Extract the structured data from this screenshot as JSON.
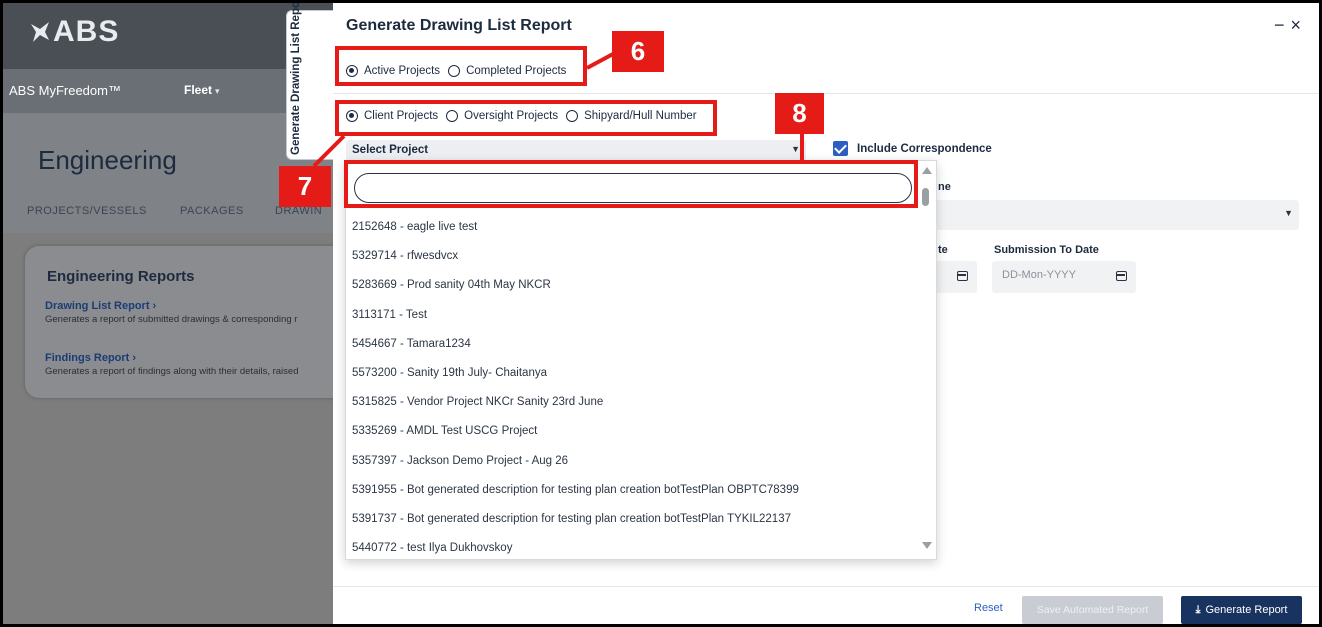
{
  "background_app": {
    "logo_text": "ABS",
    "brand": "ABS MyFreedom™",
    "fleet_label": "Fleet",
    "page_title": "Engineering",
    "tabs": [
      "PROJECTS/VESSELS",
      "PACKAGES",
      "DRAWIN"
    ],
    "reports_card": {
      "title": "Engineering Reports",
      "links": [
        {
          "label": "Drawing List Report  ›",
          "desc": "Generates a report of submitted drawings & corresponding r"
        },
        {
          "label": "Findings Report  ›",
          "desc": "Generates a report of findings along with their details, raised"
        }
      ]
    },
    "side_tab": "Generate Drawing List Report"
  },
  "modal": {
    "title": "Generate Drawing List Report",
    "minimize": "−",
    "close": "×",
    "project_status": [
      {
        "label": "Active Projects",
        "selected": true
      },
      {
        "label": "Completed Projects",
        "selected": false
      }
    ],
    "project_type": [
      {
        "label": "Client Projects",
        "selected": true
      },
      {
        "label": "Oversight Projects",
        "selected": false
      },
      {
        "label": "Shipyard/Hull Number",
        "selected": false
      }
    ],
    "select_project_label": "Select Project",
    "include_correspondence": "Include Correspondence",
    "partial_label_ne": "ne",
    "partial_label_te": "te",
    "submission_to_date_label": "Submission To Date",
    "date_placeholder": "DD-Mon-YYYY",
    "search_value": "",
    "projects": [
      "2152648 - eagle live test",
      "5329714 - rfwesdvcx",
      "5283669 - Prod sanity 04th May NKCR",
      "3113171 - Test",
      "5454667 - Tamara1234",
      "5573200 - Sanity 19th July- Chaitanya",
      "5315825 - Vendor Project NKCr Sanity 23rd June",
      "5335269 - AMDL Test USCG Project",
      "5357397 - Jackson Demo Project - Aug 26",
      "5391955 - Bot generated description for testing plan creation botTestPlan OBPTC78399",
      "5391737 - Bot generated description for testing plan creation botTestPlan TYKIL22137",
      "5440772 - test Ilya Dukhovskoy"
    ],
    "footer": {
      "reset": "Reset",
      "save_automated": "Save Automated Report",
      "generate": "Generate Report"
    }
  },
  "callouts": [
    "6",
    "7",
    "8"
  ],
  "colors": {
    "callout_red": "#e41b17",
    "primary_navy": "#18335f",
    "checkbox_blue": "#2d5fc2"
  }
}
